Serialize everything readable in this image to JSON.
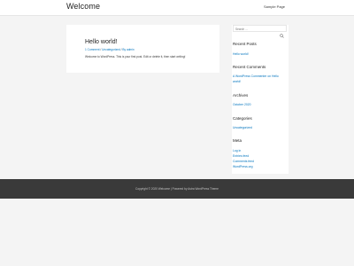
{
  "header": {
    "site_title": "Welcome",
    "nav_items": [
      "Sample Page"
    ]
  },
  "post": {
    "title": "Hello world!",
    "meta": {
      "comments": "1 Comment",
      "category": "Uncategorized",
      "author": "By admin",
      "separator": "/"
    },
    "excerpt": "Welcome to WordPress. This is your first post. Edit or delete it, then start writing!"
  },
  "sidebar": {
    "search": {
      "placeholder": "Search …",
      "icon": "search-icon"
    },
    "recent_posts": {
      "title": "Recent Posts",
      "items": [
        "Hello world!"
      ]
    },
    "recent_comments": {
      "title": "Recent Comments",
      "items": [
        "A WordPress Commenter on Hello",
        "world!"
      ]
    },
    "archives": {
      "title": "Archives",
      "items": [
        "October 2020"
      ]
    },
    "categories": {
      "title": "Categories",
      "items": [
        "Uncategorized"
      ]
    },
    "meta": {
      "title": "Meta",
      "items": [
        "Log in",
        "Entries feed",
        "Comments feed",
        "WordPress.org"
      ]
    }
  },
  "footer": {
    "text": "Copyright © 2020 Welcome | Powered by Astra WordPress Theme"
  },
  "colors": {
    "link": "#0274be",
    "footer_bg": "#3a3a3a",
    "page_bg": "#f4f4f4"
  }
}
